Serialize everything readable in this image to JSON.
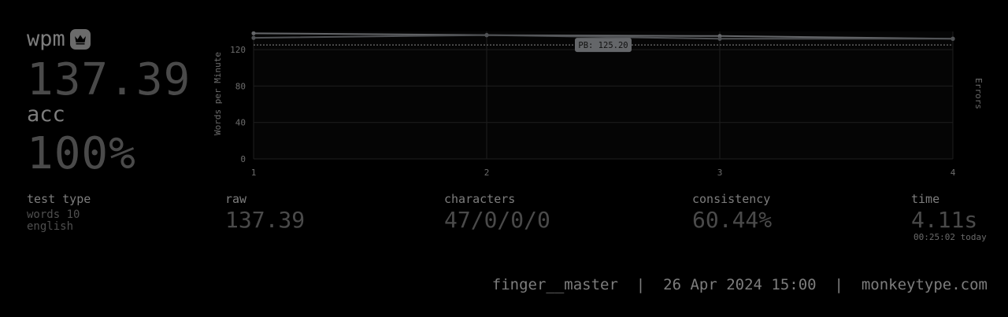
{
  "results": {
    "wpm_label": "wpm",
    "wpm_value": "137.39",
    "acc_label": "acc",
    "acc_value": "100%",
    "pb_icon": "crown-icon"
  },
  "details": {
    "test_type_label": "test type",
    "test_type_mode": "words 10",
    "test_type_language": "english",
    "raw_label": "raw",
    "raw_value": "137.39",
    "characters_label": "characters",
    "characters_value": "47/0/0/0",
    "consistency_label": "consistency",
    "consistency_value": "60.44%",
    "time_label": "time",
    "time_value": "4.11s",
    "time_of_day": "00:25:02 today"
  },
  "footer": {
    "username": "finger__master",
    "separator": "|",
    "date": "26 Apr 2024 15:00",
    "site": "monkeytype.com"
  },
  "chart_data": {
    "type": "line",
    "x": [
      1,
      2,
      3,
      4
    ],
    "ylim": [
      0,
      140
    ],
    "yticks": [
      0,
      40,
      80,
      120
    ],
    "xticks": [
      1,
      2,
      3,
      4
    ],
    "ylabel": "Words per Minute",
    "y2label": "Errors",
    "grid": true,
    "series": [
      {
        "values": [
          138,
          136,
          135,
          132
        ],
        "color": "#646669"
      },
      {
        "values": [
          133,
          136,
          132,
          132
        ],
        "color": "#4f5154"
      }
    ],
    "pb_line": {
      "value": 125.2,
      "label": "PB: 125.20"
    },
    "colors": {
      "grid": "#1e1e1e",
      "axis_text": "#6c6c6c",
      "background": "#050505"
    }
  }
}
